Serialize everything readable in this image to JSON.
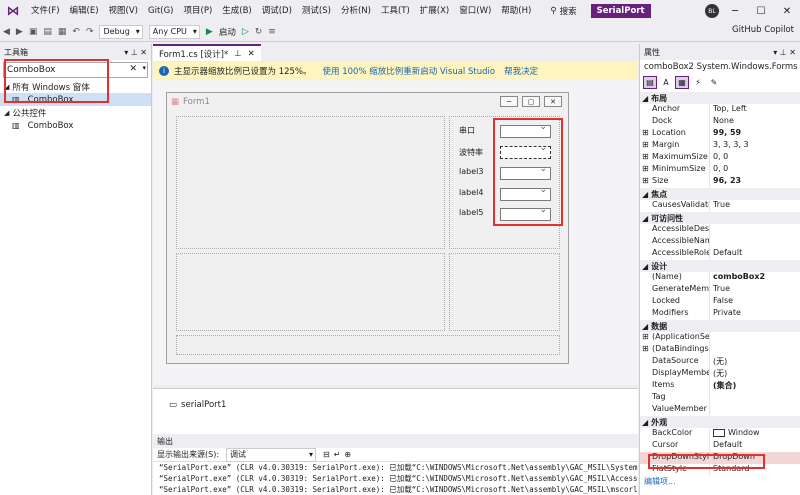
{
  "menubar": {
    "items": [
      "文件(F)",
      "编辑(E)",
      "视图(V)",
      "Git(G)",
      "项目(P)",
      "生成(B)",
      "调试(D)",
      "测试(S)",
      "分析(N)",
      "工具(T)",
      "扩展(X)",
      "窗口(W)",
      "帮助(H)"
    ],
    "search": "搜索",
    "solution": "SerialPort",
    "avatar": "BL"
  },
  "toolbar": {
    "config": "Debug",
    "platform": "Any CPU",
    "start": "启动",
    "copilot": "GitHub Copilot"
  },
  "toolbox": {
    "title": "工具箱",
    "search_value": "ComboBox",
    "group1": "所有 Windows 窗体",
    "item1": "ComboBox",
    "group2": "公共控件",
    "item2": "ComboBox"
  },
  "document": {
    "tab": "Form1.cs [设计]*",
    "info": "主显示器缩放比例已设置为 125%。",
    "info_link1": "使用 100% 缩放比例重新启动 Visual Studio",
    "info_link2": "帮我决定",
    "form_title": "Form1",
    "labels": [
      "串口",
      "波特率",
      "label3",
      "label4",
      "label5"
    ],
    "tray_item": "serialPort1"
  },
  "output": {
    "title": "输出",
    "source_label": "显示输出来源(S):",
    "source_value": "调试",
    "lines": [
      "“SerialPort.exe” (CLR v4.0.30319: SerialPort.exe): 已加载“C:\\WINDOWS\\Microsoft.Net\\assembly\\GAC_MSIL\\System.",
      "“SerialPort.exe” (CLR v4.0.30319: SerialPort.exe): 已加载“C:\\WINDOWS\\Microsoft.Net\\assembly\\GAC_MSIL\\Access",
      "“SerialPort.exe” (CLR v4.0.30319: SerialPort.exe): 已加载“C:\\WINDOWS\\Microsoft.Net\\assembly\\GAC_MSIL\\mscorl"
    ]
  },
  "properties": {
    "title": "属性",
    "object": "comboBox2  System.Windows.Forms",
    "categories": {
      "layout": "布局",
      "focus": "焦点",
      "access": "可访问性",
      "design": "设计",
      "data": "数据",
      "appearance": "外观"
    },
    "rows": {
      "anchor": [
        "Anchor",
        "Top, Left"
      ],
      "dock": [
        "Dock",
        "None"
      ],
      "location": [
        "Location",
        "99, 59"
      ],
      "margin": [
        "Margin",
        "3, 3, 3, 3"
      ],
      "maxsize": [
        "MaximumSize",
        "0, 0"
      ],
      "minsize": [
        "MinimumSize",
        "0, 0"
      ],
      "size": [
        "Size",
        "96, 23"
      ],
      "causes": [
        "CausesValidation",
        "True"
      ],
      "accdesc": [
        "AccessibleDescri",
        ""
      ],
      "accname": [
        "AccessibleName",
        ""
      ],
      "accrole": [
        "AccessibleRole",
        "Default"
      ],
      "name": [
        "(Name)",
        "comboBox2"
      ],
      "genmember": [
        "GenerateMembe",
        "True"
      ],
      "locked": [
        "Locked",
        "False"
      ],
      "modifiers": [
        "Modifiers",
        "Private"
      ],
      "appset": [
        "(ApplicationSetti",
        ""
      ],
      "databind": [
        "(DataBindings)",
        ""
      ],
      "datasource": [
        "DataSource",
        "(无)"
      ],
      "displaymember": [
        "DisplayMember",
        "(无)"
      ],
      "items": [
        "Items",
        "(集合)"
      ],
      "tag": [
        "Tag",
        ""
      ],
      "valuemember": [
        "ValueMember",
        ""
      ],
      "backcolor": [
        "BackColor",
        "Window"
      ],
      "cursor": [
        "Cursor",
        "Default"
      ],
      "dropdownstyle": [
        "DropDownStyle",
        "DropDown"
      ],
      "flatstyle": [
        "FlatStyle",
        "Standard"
      ]
    },
    "link": "编辑项..."
  },
  "colors": {
    "accent": "#68217a",
    "highlight": "#e03030",
    "info_bg": "#fdf4bf"
  }
}
